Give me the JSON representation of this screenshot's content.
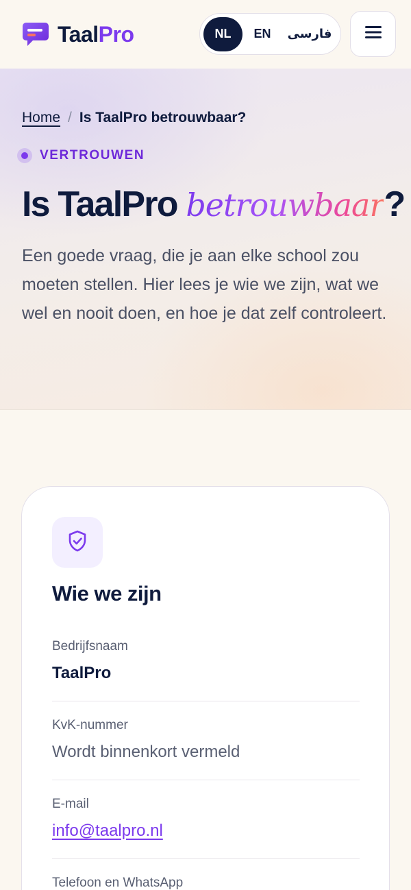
{
  "header": {
    "logo_text": "Taal",
    "logo_text_accent": "Pro",
    "languages": [
      {
        "code": "NL",
        "active": true
      },
      {
        "code": "EN",
        "active": false
      },
      {
        "code": "فارسی",
        "active": false
      }
    ]
  },
  "breadcrumb": {
    "home": "Home",
    "separator": "/",
    "current": "Is TaalPro betrouwbaar?"
  },
  "hero": {
    "eyebrow": "VERTROUWEN",
    "title_start": "Is TaalPro ",
    "title_accent": "betrouwbaar",
    "title_end": "?",
    "lead": "Een goede vraag, die je aan elke school zou moeten stellen. Hier lees je wie we zijn, wat we wel en nooit doen, en hoe je dat zelf controleert."
  },
  "card": {
    "icon": "shield-check-icon",
    "title": "Wie we zijn",
    "fields": [
      {
        "label": "Bedrijfsnaam",
        "value": "TaalPro"
      },
      {
        "label": "KvK-nummer",
        "value": "Wordt binnenkort vermeld"
      },
      {
        "label": "E-mail",
        "value": "info@taalpro.nl"
      },
      {
        "label": "Telefoon en WhatsApp",
        "value": ""
      }
    ]
  },
  "colors": {
    "brand": "#7c3aed",
    "navy": "#0f1b3d",
    "background": "#fbf7f0"
  }
}
